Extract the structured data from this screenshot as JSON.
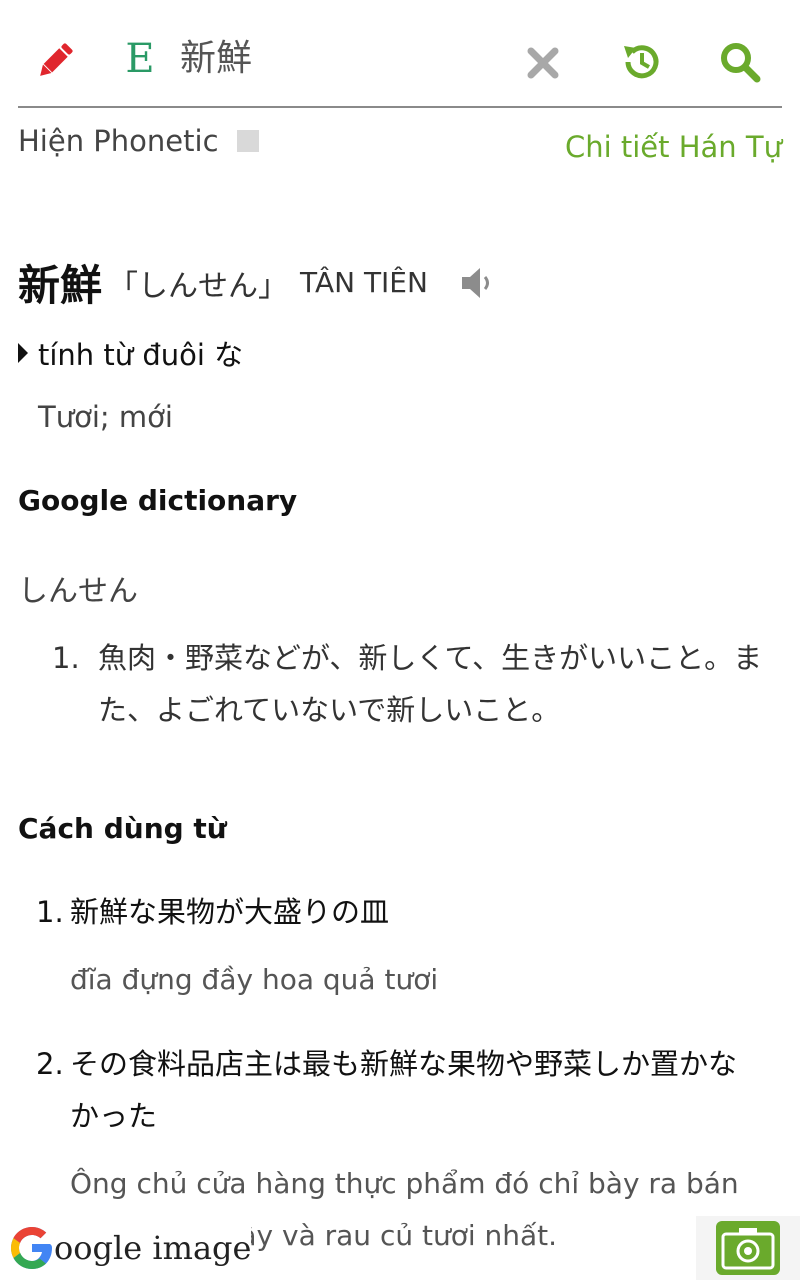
{
  "toolbar": {
    "language_label": "E",
    "query": "新鮮"
  },
  "options": {
    "phonetic_label": "Hiện Phonetic",
    "kanji_detail_link": "Chi tiết Hán Tự"
  },
  "entry": {
    "word": "新鮮",
    "reading": "「しんせん」",
    "hanviet": "TÂN TIÊN",
    "part_of_speech": "tính từ đuôi な",
    "meaning": "Tươi; mới"
  },
  "google_dictionary": {
    "title": "Google dictionary",
    "reading": "しんせん",
    "definitions": [
      {
        "num": "1.",
        "text": "魚肉・野菜などが、新しくて、生きがいいこと。また、よごれていないで新しいこと。"
      }
    ]
  },
  "usage": {
    "title": "Cách dùng từ",
    "examples": [
      {
        "num": "1.",
        "jp": "新鮮な果物が大盛りの皿",
        "vn": "đĩa đựng đầy hoa quả tươi"
      },
      {
        "num": "2.",
        "jp": "その食料品店主は最も新鮮な果物や野菜しか置かなかった",
        "vn": "Ông chủ cửa hàng thực phẩm đó chỉ bày ra bán những trái cây và rau củ tươi nhất."
      }
    ]
  },
  "footer": {
    "google_image_label": "oogle image"
  },
  "colors": {
    "accent_green": "#6aaa2c",
    "pencil_red": "#e0262d",
    "language_teal": "#2a9a66"
  },
  "icons": [
    "pencil-icon",
    "close-icon",
    "history-icon",
    "search-icon",
    "speaker-icon",
    "google-logo-icon",
    "camera-icon"
  ]
}
